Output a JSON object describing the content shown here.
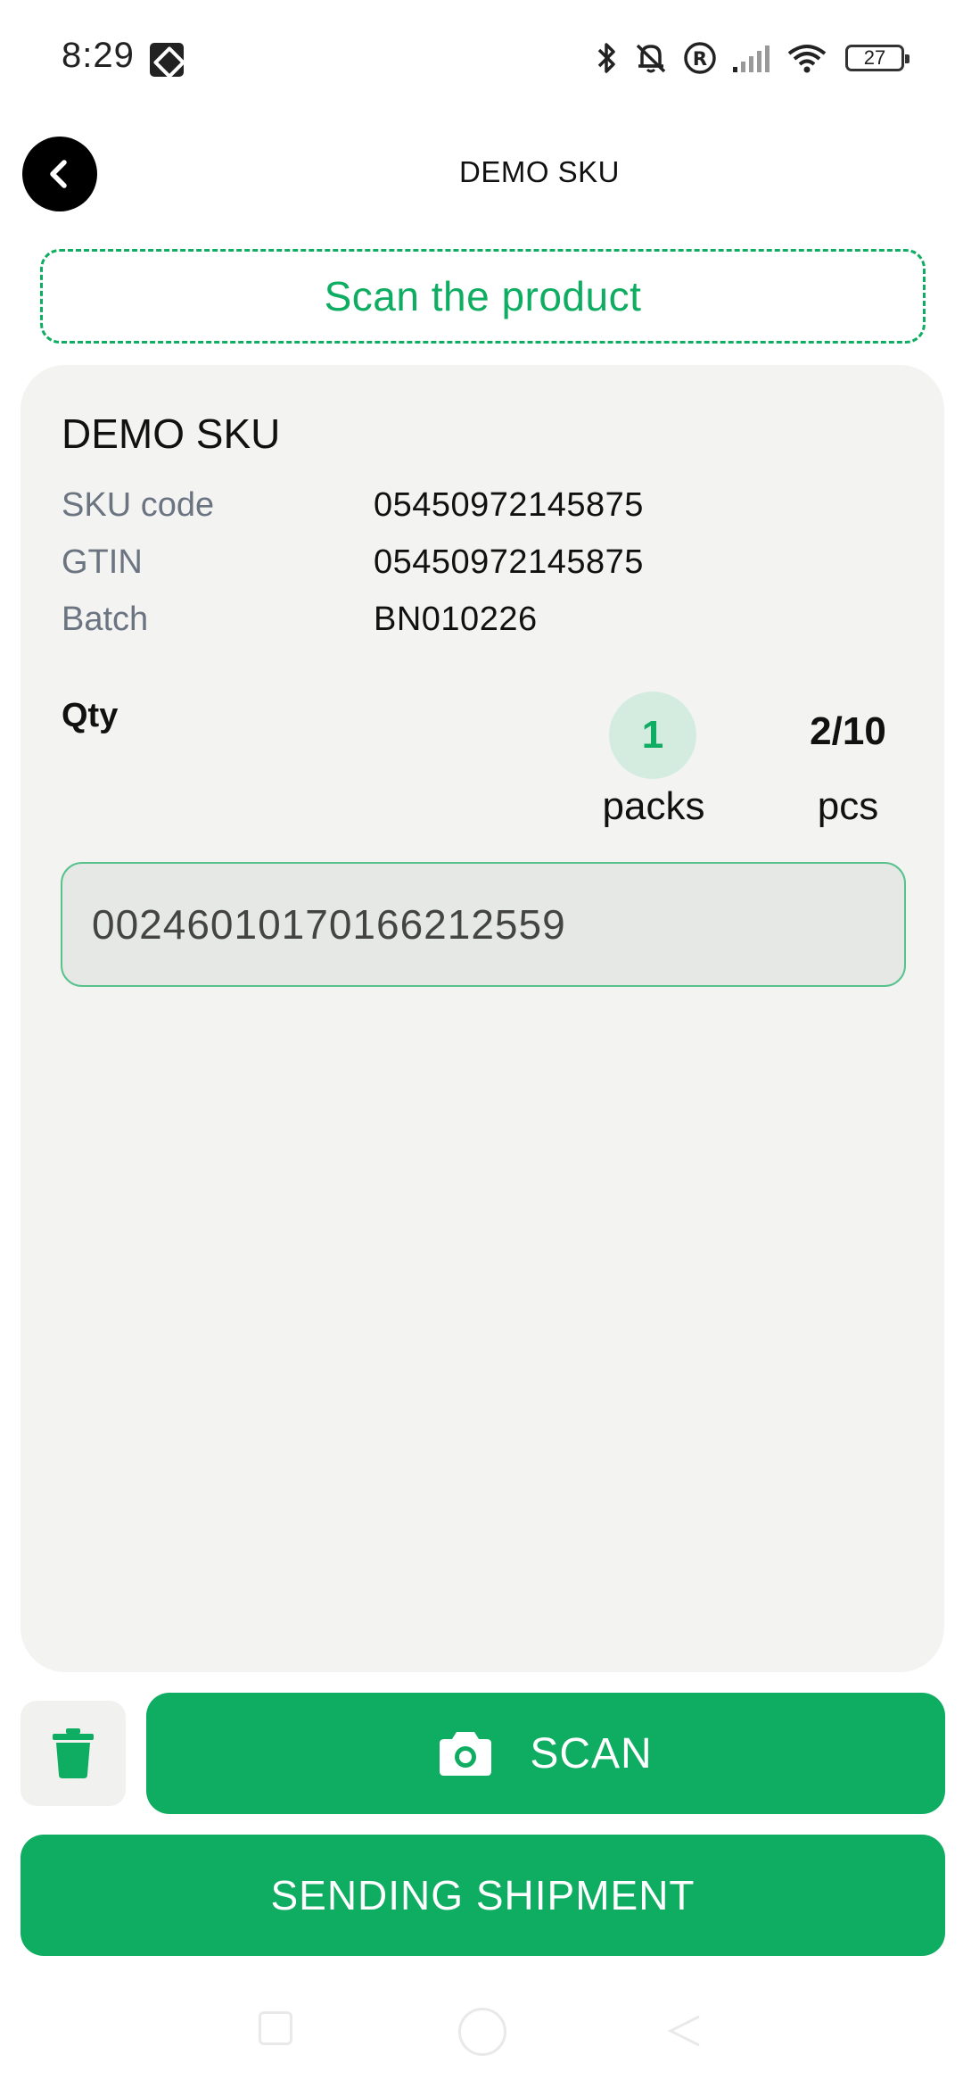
{
  "status_bar": {
    "time": "8:29",
    "battery_level": "27",
    "icons": [
      "app-notification-icon",
      "bluetooth-icon",
      "mute-icon",
      "registered-icon",
      "signal-icon",
      "wifi-icon",
      "battery-icon"
    ]
  },
  "header": {
    "title": "DEMO SKU"
  },
  "scan_hint": "Scan the product",
  "product": {
    "name": "DEMO SKU",
    "sku_code_label": "SKU code",
    "sku_code": "05450972145875",
    "gtin_label": "GTIN",
    "gtin": "05450972145875",
    "batch_label": "Batch",
    "batch": "BN010226",
    "qty_label": "Qty",
    "packs_count": "1",
    "packs_label": "packs",
    "pcs_count": "2/10",
    "pcs_label": "pcs",
    "scanned_code": "00246010170166212559"
  },
  "actions": {
    "scan_label": "SCAN",
    "send_label": "SENDING SHIPMENT"
  },
  "colors": {
    "accent": "#0ead62",
    "card_background": "#f3f4f2",
    "packs_badge": "#d3ecdf"
  }
}
